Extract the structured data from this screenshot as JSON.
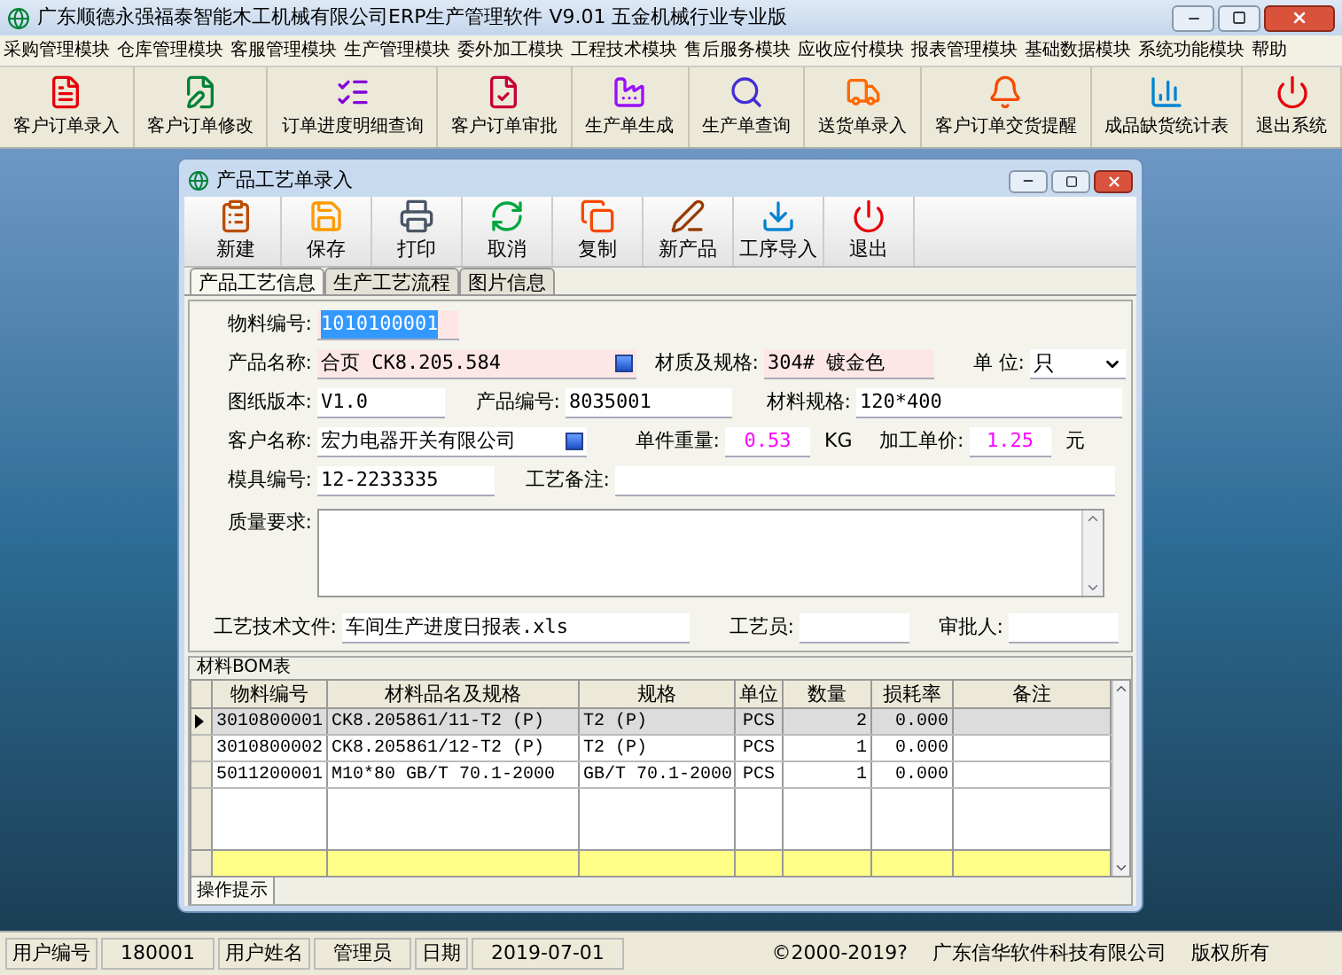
{
  "window": {
    "title": "广东顺德永强福泰智能木工机械有限公司ERP生产管理软件  V9.01 五金机械行业专业版"
  },
  "menu": [
    "采购管理模块",
    "仓库管理模块",
    "客服管理模块",
    "生产管理模块",
    "委外加工模块",
    "工程技术模块",
    "售后服务模块",
    "应收应付模块",
    "报表管理模块",
    "基础数据模块",
    "系统功能模块",
    "帮助"
  ],
  "toolbar": [
    {
      "label": "客户订单录入",
      "kind": "doc"
    },
    {
      "label": "客户订单修改",
      "kind": "edit"
    },
    {
      "label": "订单进度明细查询",
      "kind": "list"
    },
    {
      "label": "客户订单审批",
      "kind": "check"
    },
    {
      "label": "生产单生成",
      "kind": "factory"
    },
    {
      "label": "生产单查询",
      "kind": "search"
    },
    {
      "label": "送货单录入",
      "kind": "truck"
    },
    {
      "label": "客户订单交货提醒",
      "kind": "bell"
    },
    {
      "label": "成品缺货统计表",
      "kind": "chart"
    },
    {
      "label": "退出系统",
      "kind": "power"
    }
  ],
  "child_window": {
    "title": "产品工艺单录入",
    "toolbar": [
      {
        "label": "新建",
        "kind": "new"
      },
      {
        "label": "保存",
        "kind": "save"
      },
      {
        "label": "打印",
        "kind": "print"
      },
      {
        "label": "取消",
        "kind": "cancel"
      },
      {
        "label": "复制",
        "kind": "copy"
      },
      {
        "label": "新产品",
        "kind": "pen"
      },
      {
        "label": "工序导入",
        "kind": "import"
      },
      {
        "label": "退出",
        "kind": "power"
      }
    ],
    "tabs": [
      {
        "label": "产品工艺信息",
        "selected": true
      },
      {
        "label": "生产工艺流程",
        "selected": false
      },
      {
        "label": "图片信息",
        "selected": false
      }
    ],
    "form_rows": [
      [
        {
          "label": "物料编号:",
          "value": "1010100001",
          "kind": "text",
          "highlighted": true,
          "value_selected": true
        }
      ],
      [
        {
          "label": "产品名称:",
          "value": "合页 CK8.205.584",
          "kind": "lookup",
          "highlighted": true
        },
        {
          "label": "材质及规格:",
          "value": "304# 镀金色",
          "kind": "text",
          "highlighted": true
        },
        {
          "label": "单 位:",
          "value": "只",
          "kind": "select"
        }
      ],
      [
        {
          "label": "图纸版本:",
          "value": "V1.0",
          "kind": "text"
        },
        {
          "label": "产品编号:",
          "value": "8035001",
          "kind": "text"
        },
        {
          "label": "材料规格:",
          "value": "120*400",
          "kind": "text"
        }
      ],
      [
        {
          "label": "客户名称:",
          "value": "宏力电器开关有限公司",
          "kind": "lookup"
        },
        {
          "label": "单件重量:",
          "value": "0.53",
          "kind": "number",
          "unit": "KG"
        },
        {
          "label": "加工单价:",
          "value": "1.25",
          "kind": "number",
          "unit": "元"
        }
      ],
      [
        {
          "label": "模具编号:",
          "value": "12-2233335",
          "kind": "text"
        },
        {
          "label": "工艺备注:",
          "kind": "text"
        }
      ],
      [
        {
          "label": "质量要求:",
          "kind": "textarea"
        }
      ],
      [
        {
          "label": "工艺技术文件:",
          "value": "车间生产进度日报表.xls",
          "kind": "text"
        },
        {
          "label": "工艺员:",
          "kind": "text"
        },
        {
          "label": "审批人:",
          "kind": "text"
        }
      ]
    ],
    "bom": {
      "title": "材料BOM表",
      "columns": [
        "物料编号",
        "材料品名及规格",
        "规格",
        "单位",
        "数量",
        "损耗率",
        "备注"
      ],
      "rows": [
        {
          "selected": true,
          "cells": [
            "3010800001",
            "CK8.205861/11-T2 (P)",
            "T2 (P)",
            "PCS",
            "2",
            "0.000",
            ""
          ]
        },
        {
          "selected": false,
          "cells": [
            "3010800002",
            "CK8.205861/12-T2 (P)",
            "T2 (P)",
            "PCS",
            "1",
            "0.000",
            ""
          ]
        },
        {
          "selected": false,
          "cells": [
            "5011200001",
            "M10*80 GB/T 70.1-2000",
            "GB/T 70.1-2000",
            "PCS",
            "1",
            "0.000",
            ""
          ]
        }
      ]
    },
    "hint_tab": "操作提示"
  },
  "status_bar": [
    {
      "text": "用户编号",
      "kind": "label"
    },
    {
      "text": "180001",
      "kind": "value"
    },
    {
      "text": "用户姓名",
      "kind": "label"
    },
    {
      "text": "管理员",
      "kind": "value"
    },
    {
      "text": "日期",
      "kind": "label"
    },
    {
      "text": "2019-07-01",
      "kind": "value"
    },
    {
      "text": "©2000-2019?",
      "kind": "plain"
    },
    {
      "text": "广东信华软件科技有限公司",
      "kind": "plain"
    },
    {
      "text": "版权所有",
      "kind": "plain"
    }
  ]
}
